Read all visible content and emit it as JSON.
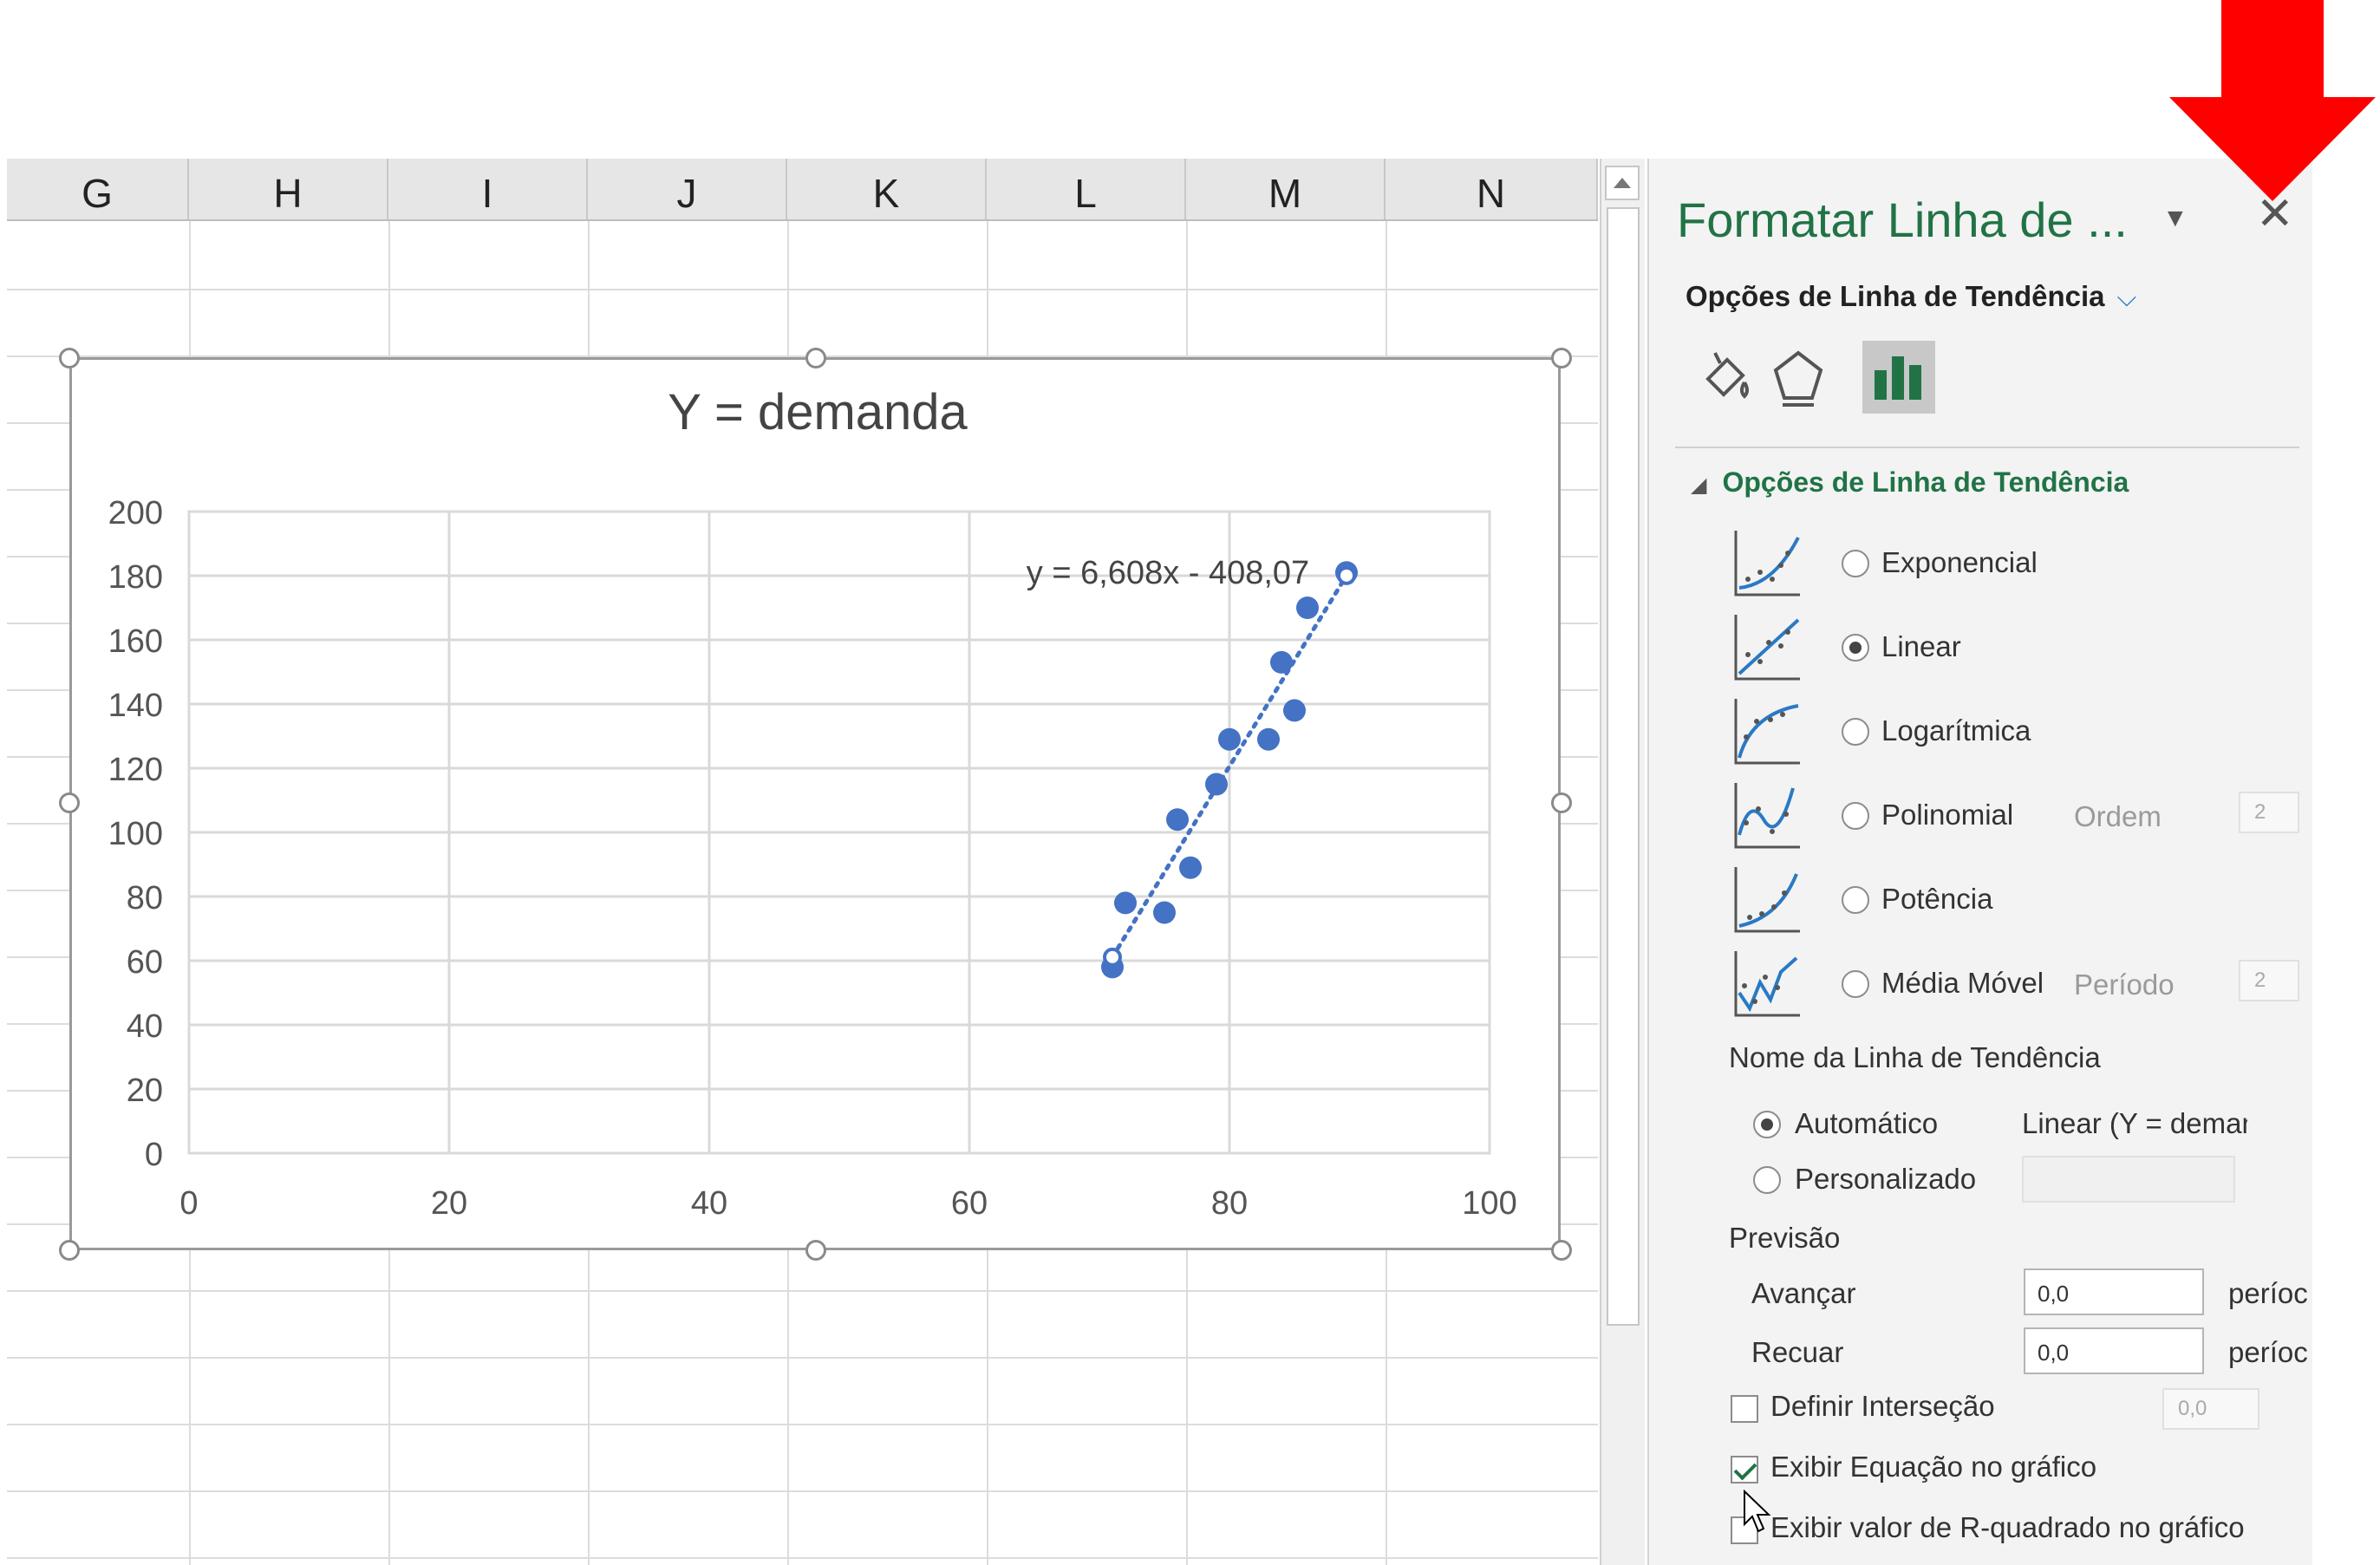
{
  "columns": [
    "G",
    "H",
    "I",
    "J",
    "K",
    "L",
    "M",
    "N"
  ],
  "chart": {
    "equation_label": "y = 6,608x - 408,07"
  },
  "chart_data": {
    "type": "scatter",
    "title": "Y = demanda",
    "xlabel": "",
    "ylabel": "",
    "xlim": [
      0,
      100
    ],
    "ylim": [
      0,
      200
    ],
    "x_ticks": [
      "0",
      "20",
      "40",
      "60",
      "80",
      "100"
    ],
    "y_ticks": [
      "0",
      "20",
      "40",
      "60",
      "80",
      "100",
      "120",
      "140",
      "160",
      "180",
      "200"
    ],
    "grid": true,
    "series": [
      {
        "points": [
          [
            71,
            58
          ],
          [
            72,
            78
          ],
          [
            75,
            75
          ],
          [
            76,
            104
          ],
          [
            77,
            89
          ],
          [
            79,
            115
          ],
          [
            80,
            129
          ],
          [
            83,
            129
          ],
          [
            84,
            153
          ],
          [
            85,
            138
          ],
          [
            86,
            170
          ],
          [
            89,
            181
          ]
        ]
      }
    ],
    "trendline": {
      "type": "linear",
      "slope": 6.608,
      "intercept": -408.07,
      "x_range": [
        71,
        89
      ],
      "color": "#4472c4"
    },
    "marker_color": "#4472c4"
  },
  "pane": {
    "title": "Formatar Linha de ...",
    "section": "Opções de Linha de Tendência",
    "group": "Opções de Linha de Tendência",
    "options": [
      {
        "label": "Exponencial",
        "selected": false
      },
      {
        "label": "Linear",
        "selected": true
      },
      {
        "label": "Logarítmica",
        "selected": false
      },
      {
        "label": "Polinomial",
        "selected": false
      },
      {
        "label": "Potência",
        "selected": false
      },
      {
        "label": "Média Móvel",
        "selected": false
      }
    ],
    "order_label": "Ordem",
    "order_value": "2",
    "period_label": "Período",
    "period_value": "2",
    "name_label": "Nome da Linha de Tendência",
    "auto_label": "Automático",
    "auto_value": "Linear (Y = demanc",
    "custom_label": "Personalizado",
    "forecast_label": "Previsão",
    "forward_label": "Avançar",
    "forward_value": "0,0",
    "backward_label": "Recuar",
    "backward_value": "0,0",
    "period_unit": "períoc",
    "intercept_label": "Definir Interseção",
    "intercept_value": "0,0",
    "show_equation_label": "Exibir Equação no gráfico",
    "show_r2_label": "Exibir valor de R-quadrado no gráfico"
  },
  "colors": {
    "accent": "#217346",
    "marker": "#4472c4",
    "arrow": "#ff0000"
  }
}
